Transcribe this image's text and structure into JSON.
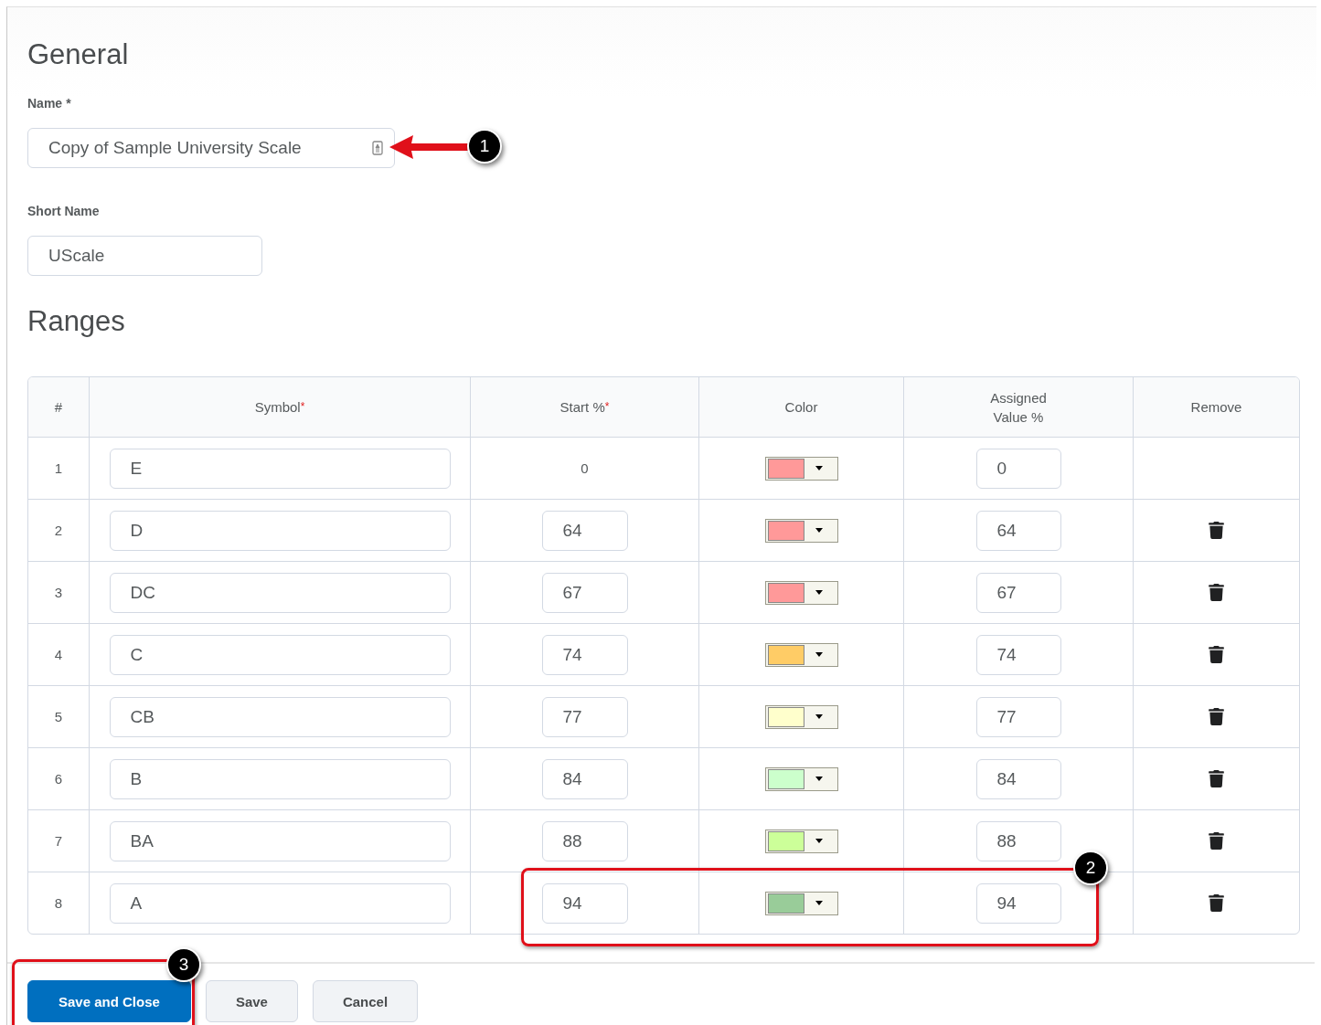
{
  "general": {
    "heading": "General",
    "name_field": {
      "label": "Name",
      "required_mark": "*",
      "value": "Copy of Sample University Scale"
    },
    "short_name_field": {
      "label": "Short Name",
      "value": "UScale"
    }
  },
  "ranges": {
    "heading": "Ranges",
    "columns": [
      {
        "label": "#"
      },
      {
        "label": "Symbol",
        "required_mark": "*"
      },
      {
        "label": "Start %",
        "required_mark": "*"
      },
      {
        "label": "Color"
      },
      {
        "label": "Assigned Value %"
      },
      {
        "label": "Remove"
      }
    ],
    "rows": [
      {
        "number": "1",
        "symbol": "E",
        "start": {
          "kind": "text",
          "value": "0"
        },
        "color": "#ff9999",
        "assigned": "0",
        "removable": false
      },
      {
        "number": "2",
        "symbol": "D",
        "start": {
          "kind": "field",
          "value": "64"
        },
        "color": "#ff9999",
        "assigned": "64",
        "removable": true
      },
      {
        "number": "3",
        "symbol": "DC",
        "start": {
          "kind": "field",
          "value": "67"
        },
        "color": "#ff9999",
        "assigned": "67",
        "removable": true
      },
      {
        "number": "4",
        "symbol": "C",
        "start": {
          "kind": "field",
          "value": "74"
        },
        "color": "#ffcc66",
        "assigned": "74",
        "removable": true
      },
      {
        "number": "5",
        "symbol": "CB",
        "start": {
          "kind": "field",
          "value": "77"
        },
        "color": "#ffffcc",
        "assigned": "77",
        "removable": true
      },
      {
        "number": "6",
        "symbol": "B",
        "start": {
          "kind": "field",
          "value": "84"
        },
        "color": "#ccffcc",
        "assigned": "84",
        "removable": true
      },
      {
        "number": "7",
        "symbol": "BA",
        "start": {
          "kind": "field",
          "value": "88"
        },
        "color": "#ccff99",
        "assigned": "88",
        "removable": true
      },
      {
        "number": "8",
        "symbol": "A",
        "start": {
          "kind": "field",
          "value": "94"
        },
        "color": "#99cc99",
        "assigned": "94",
        "removable": true
      }
    ]
  },
  "buttons": [
    {
      "label": "Save and Close",
      "primary": true
    },
    {
      "label": "Save",
      "primary": false
    },
    {
      "label": "Cancel",
      "primary": false
    }
  ],
  "callouts": [
    "1",
    "2",
    "3"
  ]
}
